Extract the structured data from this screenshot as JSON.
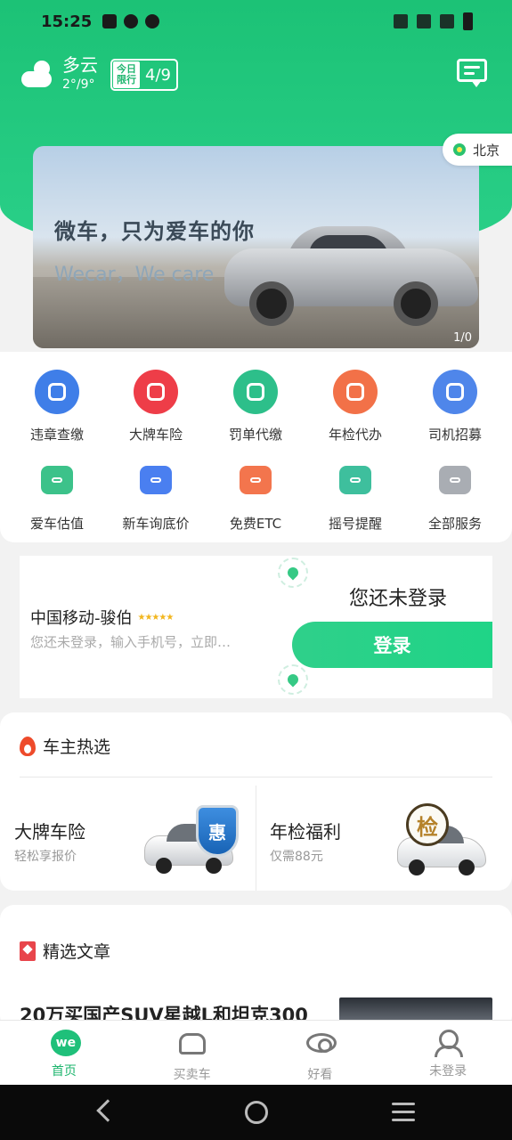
{
  "status_bar": {
    "time": "15:25"
  },
  "weather": {
    "condition": "多云",
    "temp": "2°/9°"
  },
  "traffic_limit": {
    "label": "今日限行",
    "numbers": "4/9"
  },
  "city": "北京",
  "banner": {
    "title": "微车，只为爱车的你",
    "subtitle": "Wecar，We care",
    "page": "1/0"
  },
  "services": [
    {
      "label": "违章查缴",
      "color": "#3f7ee8"
    },
    {
      "label": "大牌车险",
      "color": "#ee3d48"
    },
    {
      "label": "罚单代缴",
      "color": "#2dbf8a"
    },
    {
      "label": "年检代办",
      "color": "#f27148"
    },
    {
      "label": "司机招募",
      "color": "#4f86ea"
    },
    {
      "label": "爱车估值",
      "color": "#3cc28a"
    },
    {
      "label": "新车询底价",
      "color": "#4a7ff0"
    },
    {
      "label": "免费ETC",
      "color": "#f3754d"
    },
    {
      "label": "摇号提醒",
      "color": "#3ebf9d"
    },
    {
      "label": "全部服务",
      "color": "#a9adb3"
    }
  ],
  "login_card": {
    "carrier": "中国移动-骏伯",
    "stars": "★★★★★",
    "subtitle": "您还未登录，输入手机号，立即…",
    "not_logged_in": "您还未登录",
    "login_button": "登录"
  },
  "hot": {
    "title": "车主热选",
    "items": [
      {
        "title": "大牌车险",
        "subtitle": "轻松享报价",
        "badge": "惠"
      },
      {
        "title": "年检福利",
        "subtitle": "仅需88元",
        "badge": "检"
      }
    ]
  },
  "articles": {
    "title": "精选文章",
    "first_title": "20万买国产SUV星越L和坦克300"
  },
  "tabbar": {
    "home": "首页",
    "buy_sell": "买卖车",
    "watch": "好看",
    "profile": "未登录",
    "home_logo": "we"
  }
}
